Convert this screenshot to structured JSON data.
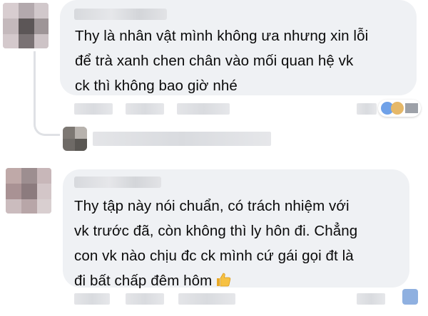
{
  "comments": [
    {
      "text_lines": [
        "Thy là nhân vật mình không ưa nhưng xin lỗi",
        "để trà xanh chen chân vào mối quan hệ vk",
        "ck thì không bao giờ nhé"
      ]
    },
    {
      "text_lines": [
        "Thy tập này nói chuẩn, có trách nhiệm với",
        "vk trước đã, còn không thì ly hôn đi. Chẳng",
        "con vk nào chịu đc ck mình cứ gái gọi đt là",
        "đi bất chấp đêm hôm"
      ],
      "emoji_icon": "thumbs-up-icon"
    }
  ],
  "colors": {
    "bubble": "#eff1f4",
    "text": "#0a0a0a",
    "thread_line": "#dfe1e5",
    "blur": "#dadce0",
    "thumb_yellow": "#f6c143",
    "reaction_blue": "#4a90e2"
  }
}
